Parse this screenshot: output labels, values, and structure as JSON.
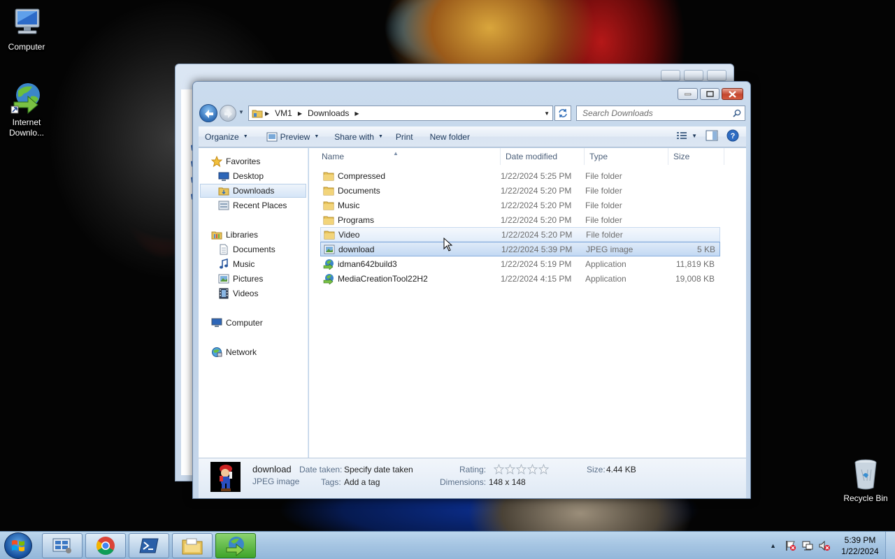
{
  "desktop": {
    "icons": [
      {
        "label": "Computer"
      },
      {
        "label": "Internet Downlo..."
      },
      {
        "label": "Recycle Bin"
      }
    ]
  },
  "explorer": {
    "address": {
      "crumbs": [
        "VM1",
        "Downloads"
      ]
    },
    "search": {
      "placeholder": "Search Downloads"
    },
    "commands": {
      "organize": "Organize",
      "preview": "Preview",
      "share_with": "Share with",
      "print": "Print",
      "new_folder": "New folder"
    },
    "nav_pane": {
      "favorites": "Favorites",
      "favorites_items": [
        "Desktop",
        "Downloads",
        "Recent Places"
      ],
      "libraries": "Libraries",
      "libraries_items": [
        "Documents",
        "Music",
        "Pictures",
        "Videos"
      ],
      "computer": "Computer",
      "network": "Network"
    },
    "columns": {
      "name": "Name",
      "date_modified": "Date modified",
      "type": "Type",
      "size": "Size"
    },
    "files": [
      {
        "name": "Compressed",
        "date": "1/22/2024 5:25 PM",
        "type": "File folder",
        "size": "",
        "icon": "folder-icon"
      },
      {
        "name": "Documents",
        "date": "1/22/2024 5:20 PM",
        "type": "File folder",
        "size": "",
        "icon": "folder-icon"
      },
      {
        "name": "Music",
        "date": "1/22/2024 5:20 PM",
        "type": "File folder",
        "size": "",
        "icon": "folder-icon"
      },
      {
        "name": "Programs",
        "date": "1/22/2024 5:20 PM",
        "type": "File folder",
        "size": "",
        "icon": "folder-icon"
      },
      {
        "name": "Video",
        "date": "1/22/2024 5:20 PM",
        "type": "File folder",
        "size": "",
        "icon": "folder-icon"
      },
      {
        "name": "download",
        "date": "1/22/2024 5:39 PM",
        "type": "JPEG image",
        "size": "5 KB",
        "icon": "image-file-icon"
      },
      {
        "name": "idman642build3",
        "date": "1/22/2024 5:19 PM",
        "type": "Application",
        "size": "11,819 KB",
        "icon": "app-icon"
      },
      {
        "name": "MediaCreationTool22H2",
        "date": "1/22/2024 4:15 PM",
        "type": "Application",
        "size": "19,008 KB",
        "icon": "app-icon"
      }
    ],
    "details": {
      "file_name": "download",
      "file_type": "JPEG image",
      "date_taken_label": "Date taken:",
      "date_taken_value": "Specify date taken",
      "tags_label": "Tags:",
      "tags_value": "Add a tag",
      "rating_label": "Rating:",
      "rating_value": 0,
      "dimensions_label": "Dimensions:",
      "dimensions_value": "148 x 148",
      "size_label": "Size:",
      "size_value": "4.44 KB"
    }
  },
  "taskbar": {
    "clock_time": "5:39 PM",
    "clock_date": "1/22/2024"
  }
}
